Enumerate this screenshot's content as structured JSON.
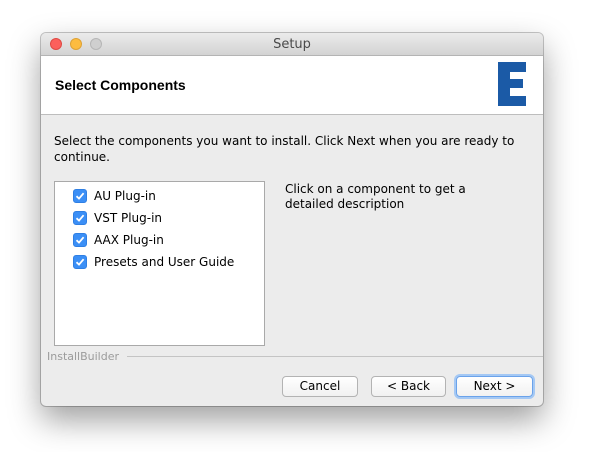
{
  "window": {
    "title": "Setup"
  },
  "header": {
    "title": "Select Components",
    "logo_letter": "E",
    "logo_color": "#1b5aa6"
  },
  "instruction": "Select the components you want to install. Click Next when you are ready to continue.",
  "components": [
    {
      "label": "AU Plug-in",
      "checked": true
    },
    {
      "label": "VST Plug-in",
      "checked": true
    },
    {
      "label": "AAX Plug-in",
      "checked": true
    },
    {
      "label": "Presets and User Guide",
      "checked": true
    }
  ],
  "description": "Click on a component to get a detailed description",
  "footer": {
    "brand": "InstallBuilder"
  },
  "buttons": {
    "cancel": "Cancel",
    "back": "< Back",
    "next": "Next >"
  },
  "colors": {
    "checkbox": "#3b8ff6",
    "default_button_focus": "#6aa2ea"
  }
}
